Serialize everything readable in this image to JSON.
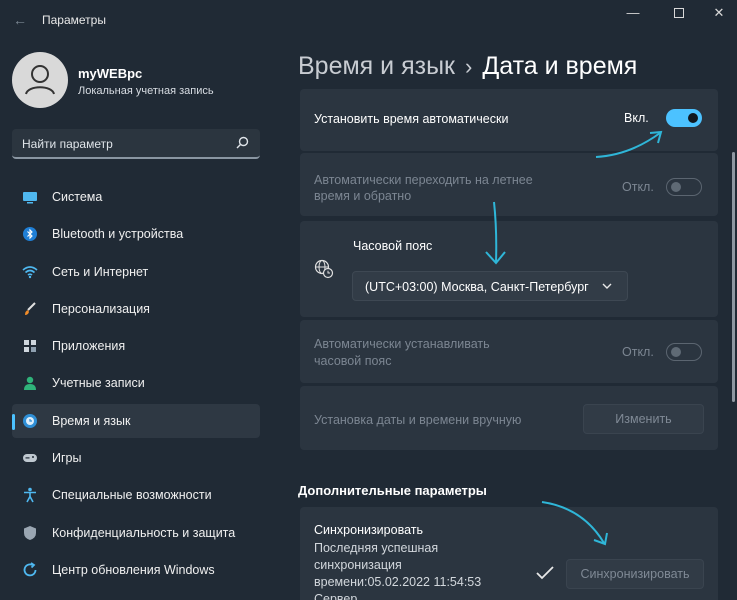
{
  "window": {
    "title": "Параметры"
  },
  "profile": {
    "name": "myWEBpc",
    "account_type": "Локальная учетная запись"
  },
  "search": {
    "placeholder": "Найти параметр"
  },
  "sidebar": {
    "items": [
      {
        "label": "Система",
        "icon": "monitor-icon"
      },
      {
        "label": "Bluetooth и устройства",
        "icon": "bluetooth-icon"
      },
      {
        "label": "Сеть и Интернет",
        "icon": "wifi-icon"
      },
      {
        "label": "Персонализация",
        "icon": "brush-icon"
      },
      {
        "label": "Приложения",
        "icon": "apps-icon"
      },
      {
        "label": "Учетные записи",
        "icon": "person-icon"
      },
      {
        "label": "Время и язык",
        "icon": "globe-clock-icon",
        "active": true
      },
      {
        "label": "Игры",
        "icon": "gamepad-icon"
      },
      {
        "label": "Специальные возможности",
        "icon": "accessibility-icon"
      },
      {
        "label": "Конфиденциальность и защита",
        "icon": "shield-icon"
      },
      {
        "label": "Центр обновления Windows",
        "icon": "update-icon"
      }
    ]
  },
  "breadcrumb": {
    "parent": "Время и язык",
    "separator": "›",
    "current": "Дата и время"
  },
  "settings": {
    "auto_time": {
      "label": "Установить время автоматически",
      "state": "Вкл.",
      "on": true
    },
    "dst": {
      "label_line1": "Автоматически переходить на летнее",
      "label_line2": "время и обратно",
      "state": "Откл.",
      "on": false
    },
    "timezone": {
      "label": "Часовой пояс",
      "value": "(UTC+03:00) Москва, Санкт-Петербург"
    },
    "auto_timezone": {
      "label_line1": "Автоматически устанавливать",
      "label_line2": "часовой пояс",
      "state": "Откл.",
      "on": false
    },
    "manual": {
      "label": "Установка даты и времени вручную",
      "button": "Изменить"
    }
  },
  "additional": {
    "title": "Дополнительные параметры",
    "sync": {
      "label": "Синхронизировать",
      "line1": "Последняя успешная",
      "line2": "синхронизация",
      "line3": "времени:05.02.2022 11:54:53",
      "line4": "Сервер",
      "button": "Синхронизировать"
    }
  },
  "colors": {
    "accent": "#4cc2ff",
    "background": "#202a35",
    "card": "#2b3540",
    "annotation": "#2fb6d8"
  }
}
